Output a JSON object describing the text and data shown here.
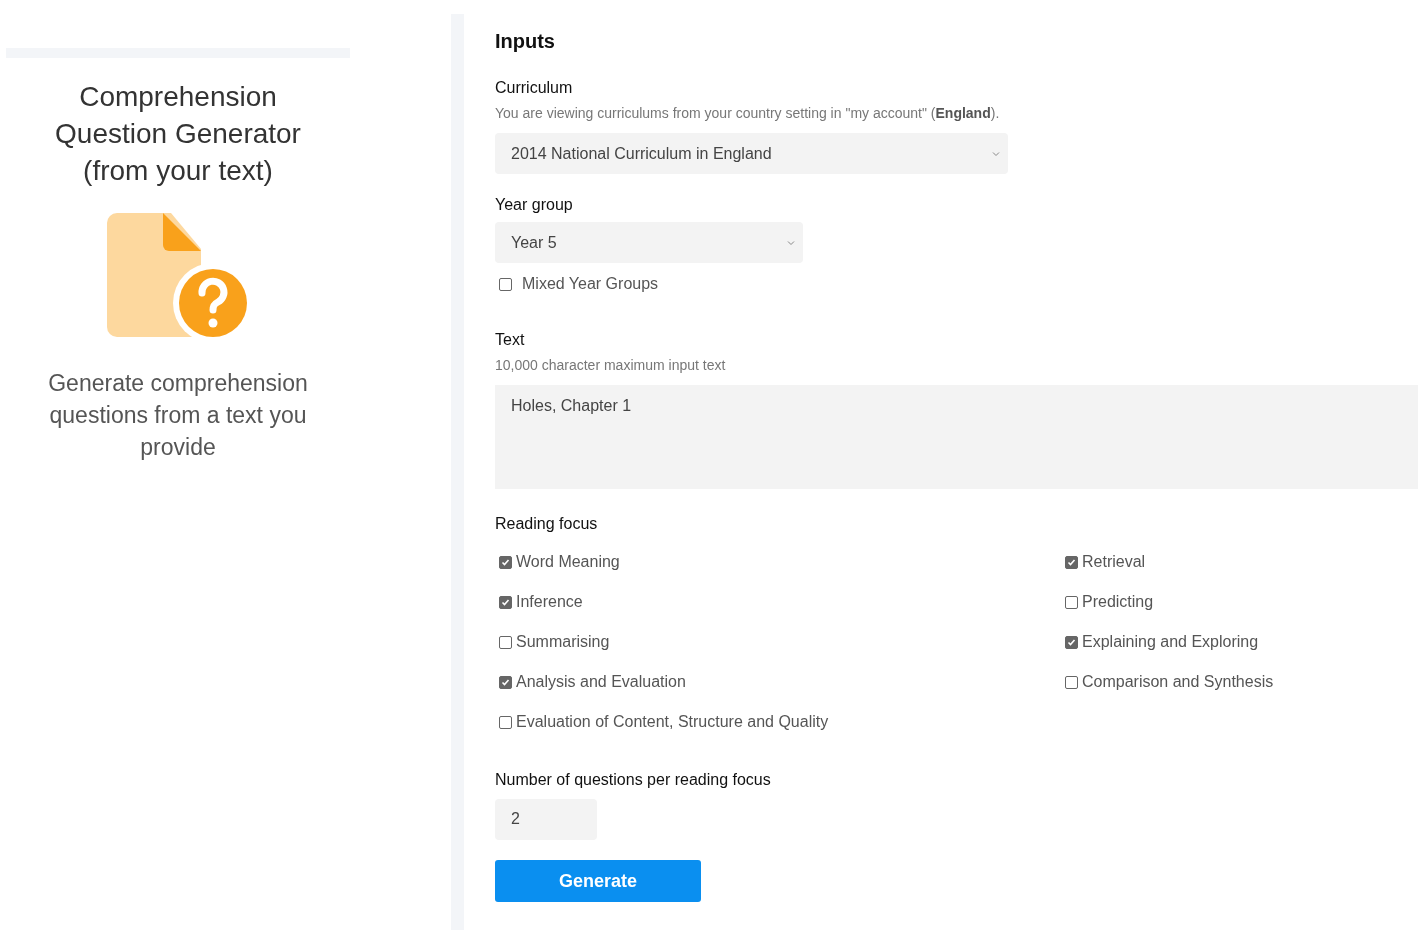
{
  "tool_card": {
    "title": "Comprehension Question Generator (from your text)",
    "description": "Generate comprehension questions from a text you provide"
  },
  "inputs": {
    "heading": "Inputs",
    "curriculum": {
      "label": "Curriculum",
      "note": "You are viewing curriculums from your country setting in \"my account\" (**England**).",
      "value": "2014 National Curriculum in England"
    },
    "year_group": {
      "label": "Year group",
      "value": "Year 5",
      "mixed": {
        "label": "Mixed Year Groups",
        "checked": false
      }
    },
    "text": {
      "label": "Text",
      "note": "10,000 character maximum input text",
      "value": "Holes, Chapter 1"
    },
    "reading_focus": {
      "label": "Reading focus",
      "options": [
        {
          "label": "Word Meaning",
          "checked": true
        },
        {
          "label": "Retrieval",
          "checked": true
        },
        {
          "label": "Inference",
          "checked": true
        },
        {
          "label": "Predicting",
          "checked": false
        },
        {
          "label": "Summarising",
          "checked": false
        },
        {
          "label": "Explaining and Exploring",
          "checked": true
        },
        {
          "label": "Analysis and Evaluation",
          "checked": true
        },
        {
          "label": "Comparison and Synthesis",
          "checked": false
        },
        {
          "label": "Evaluation of Content, Structure and Quality",
          "checked": false
        }
      ]
    },
    "questions": {
      "label": "Number of questions per reading focus",
      "value": "2"
    },
    "button": "Generate"
  }
}
